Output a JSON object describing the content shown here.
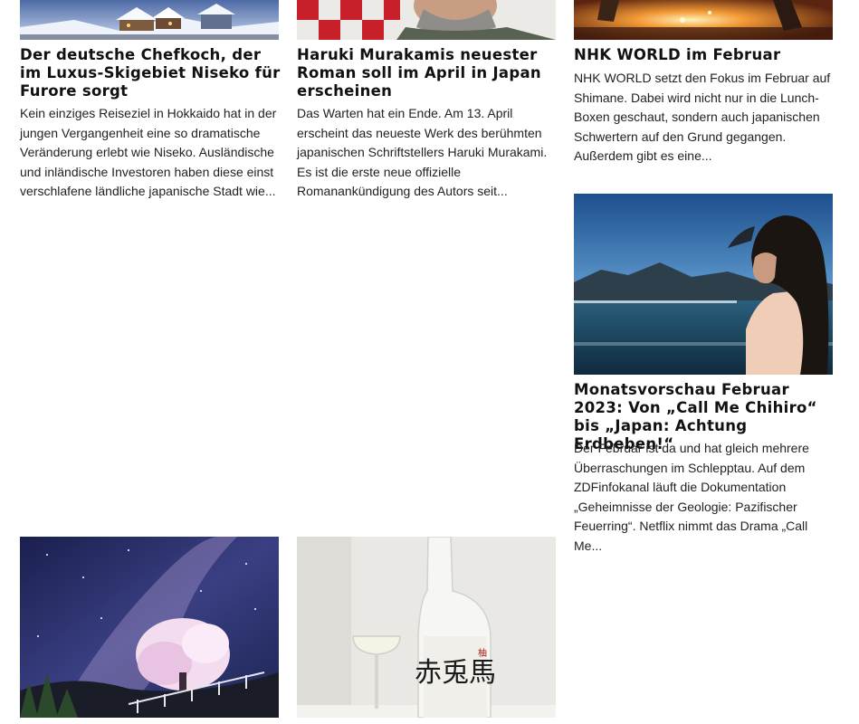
{
  "articles": [
    {
      "title": "Der deutsche Chefkoch, der im Luxus-Skigebiet Niseko für Furore sorgt",
      "excerpt": "Kein einziges Reiseziel in Hokkaido hat in der jungen Vergangenheit eine so dramatische Veränderung erlebt wie Niseko. Ausländische und inländische Investoren haben diese einst verschlafene ländliche japanische Stadt wie...",
      "image": "snowy-village-photo"
    },
    {
      "title": "Haruki Murakamis neuester Roman soll im April in Japan erscheinen",
      "excerpt": "Das Warten hat ein Ende. Am 13. April erscheint das neueste Werk des berühmten japanischen Schriftstellers Haruki Murakami. Es ist die erste neue offizielle Romanankündigung des Autors seit...",
      "image": "author-portrait-photo"
    },
    {
      "title": "NHK WORLD im Februar",
      "excerpt": "NHK WORLD setzt den Fokus im Februar auf Shimane. Dabei wird nicht nur in die Lunch-Boxen geschaut, sondern auch japanischen Schwertern auf den Grund gegangen. Außerdem gibt es eine...",
      "image": "sword-forging-photo"
    },
    {
      "title": "Monatsvorschau Februar 2023: Von „Call Me Chihiro“ bis „Japan: Achtung Erdbeben!“",
      "excerpt": "Der Februar ist da und hat gleich mehrere Überraschungen im Schlepptau. Auf dem ZDFinfokanal läuft die Dokumentation „Geheimnisse der Geologie: Pazifischer Feuerring“. Netflix nimmt das Drama „Call Me...",
      "image": "woman-by-sea-photo"
    },
    {
      "title": "",
      "excerpt": "",
      "image": "cherry-tree-milky-way-photo"
    },
    {
      "title": "",
      "excerpt": "",
      "image": "sake-bottle-glass-photo",
      "label_text": "赤兎馬"
    }
  ]
}
